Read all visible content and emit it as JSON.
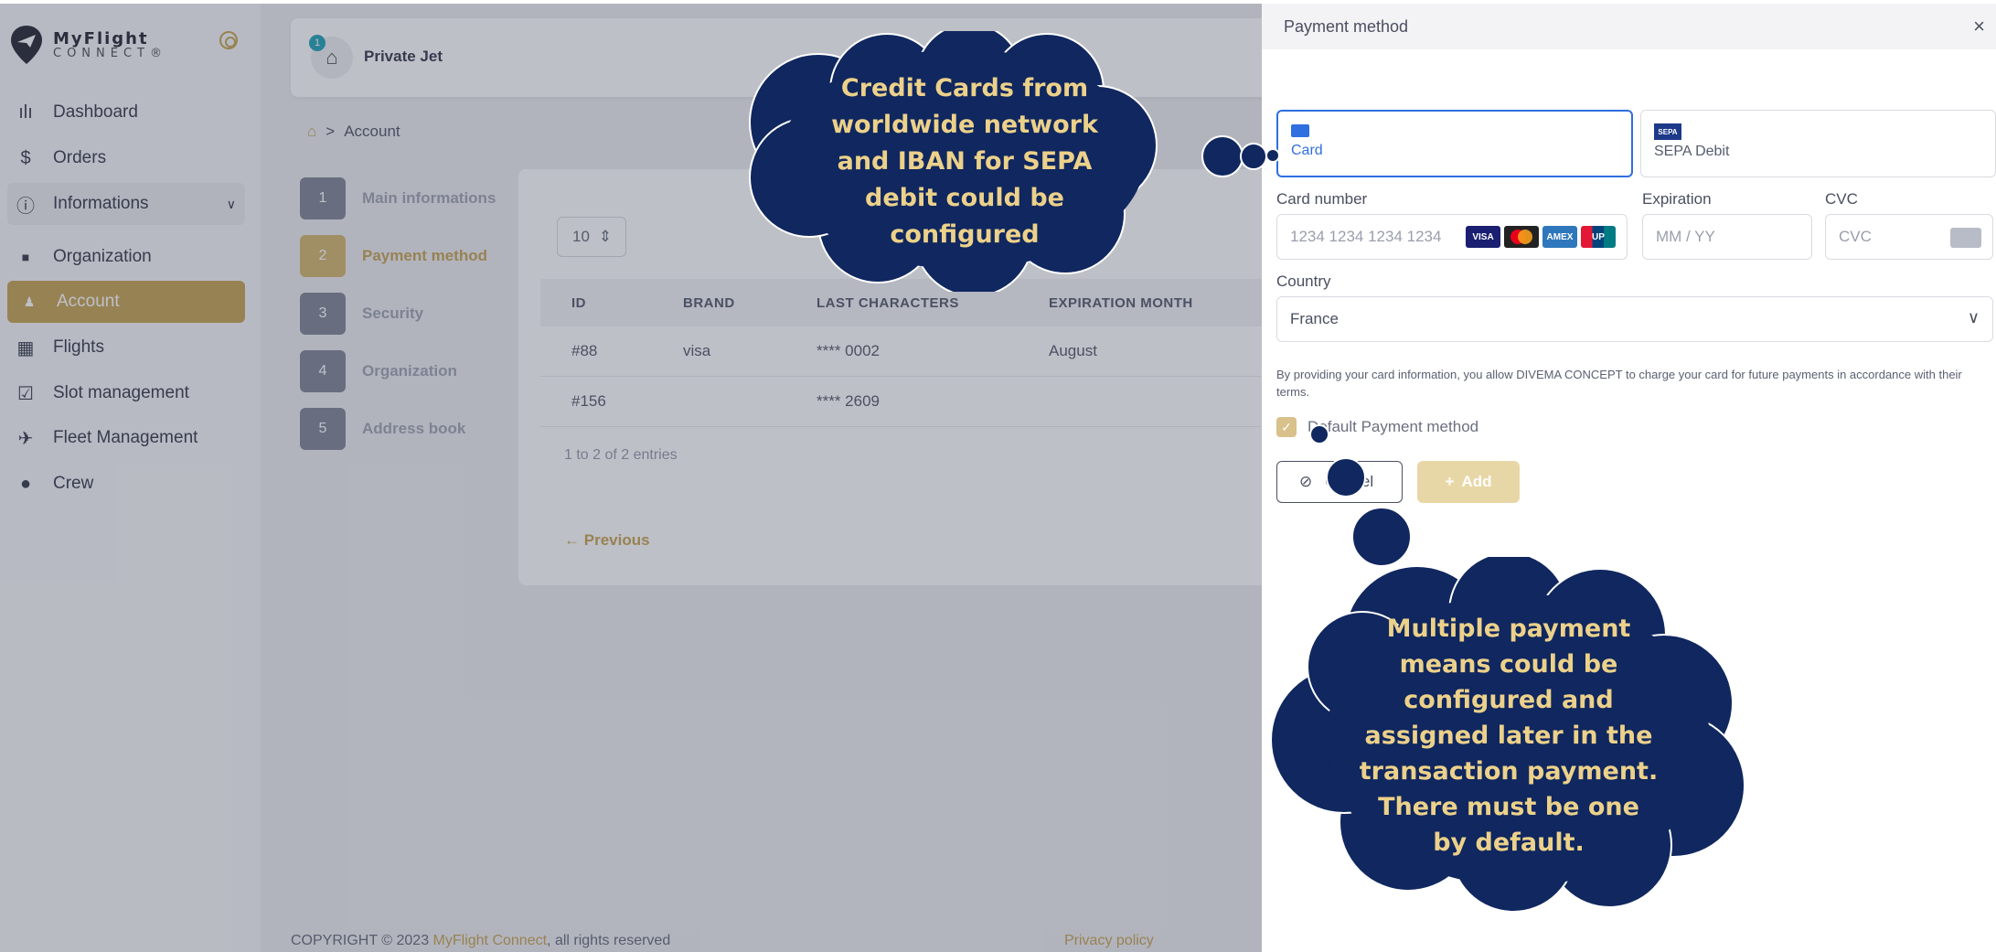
{
  "sidebar": {
    "logo": {
      "line1": "MyFlight",
      "line2": "CONNECT®"
    },
    "items": [
      {
        "label": "Dashboard",
        "icon": "bar-chart-icon"
      },
      {
        "label": "Orders",
        "icon": "dollar-icon"
      },
      {
        "label": "Informations",
        "icon": "info-icon"
      },
      {
        "label": "Organization",
        "icon": "building-icon"
      },
      {
        "label": "Account",
        "icon": "users-icon"
      },
      {
        "label": "Flights",
        "icon": "briefcase-icon"
      },
      {
        "label": "Slot management",
        "icon": "calendar-check-icon"
      },
      {
        "label": "Fleet Management",
        "icon": "plane-icon"
      },
      {
        "label": "Crew",
        "icon": "user-icon"
      }
    ]
  },
  "topbar": {
    "badge_count": "1",
    "title": "Private Jet"
  },
  "breadcrumb": {
    "sep": ">",
    "current": "Account"
  },
  "steps": [
    {
      "num": "1",
      "label": "Main informations"
    },
    {
      "num": "2",
      "label": "Payment method"
    },
    {
      "num": "3",
      "label": "Security"
    },
    {
      "num": "4",
      "label": "Organization"
    },
    {
      "num": "5",
      "label": "Address book"
    }
  ],
  "table": {
    "page_size": "10",
    "headers": [
      "ID",
      "BRAND",
      "LAST CHARACTERS",
      "EXPIRATION MONTH"
    ],
    "rows": [
      [
        "#88",
        "visa",
        "**** 0002",
        "August"
      ],
      [
        "#156",
        "",
        "**** 2609",
        ""
      ]
    ],
    "entries": "1 to 2 of 2 entries",
    "previous": "Previous"
  },
  "footer": {
    "prefix": "COPYRIGHT © 2023 ",
    "brand": "MyFlight Connect",
    "suffix": ", all rights reserved",
    "privacy": "Privacy policy"
  },
  "panel": {
    "title": "Payment method",
    "close": "×",
    "tabs": [
      {
        "label": "Card"
      },
      {
        "label": "SEPA Debit",
        "badge": "SEPA"
      }
    ],
    "card_number": {
      "label": "Card number",
      "placeholder": "1234 1234 1234 1234",
      "brands": [
        "VISA",
        "MC",
        "AMEX",
        "UP"
      ]
    },
    "expiration": {
      "label": "Expiration",
      "placeholder": "MM / YY"
    },
    "cvc": {
      "label": "CVC",
      "placeholder": "CVC"
    },
    "country": {
      "label": "Country",
      "value": "France"
    },
    "disclaimer": "By providing your card information, you allow DIVEMA CONCEPT to charge your card for future payments in accordance with their terms.",
    "default_checkbox": {
      "label": "Default Payment method",
      "checked": true
    },
    "cancel": "Cancel",
    "add": "Add"
  },
  "callouts": {
    "top": "Credit Cards from worldwide network and IBAN for SEPA debit could be configured",
    "bottom": "Multiple payment means could be configured and assigned later in the transaction payment. There must be one by default."
  },
  "colors": {
    "accent": "#c8a659",
    "callout_fill": "#10275f",
    "callout_text": "#ecd18a",
    "selected_tab": "#2f6fe0"
  }
}
